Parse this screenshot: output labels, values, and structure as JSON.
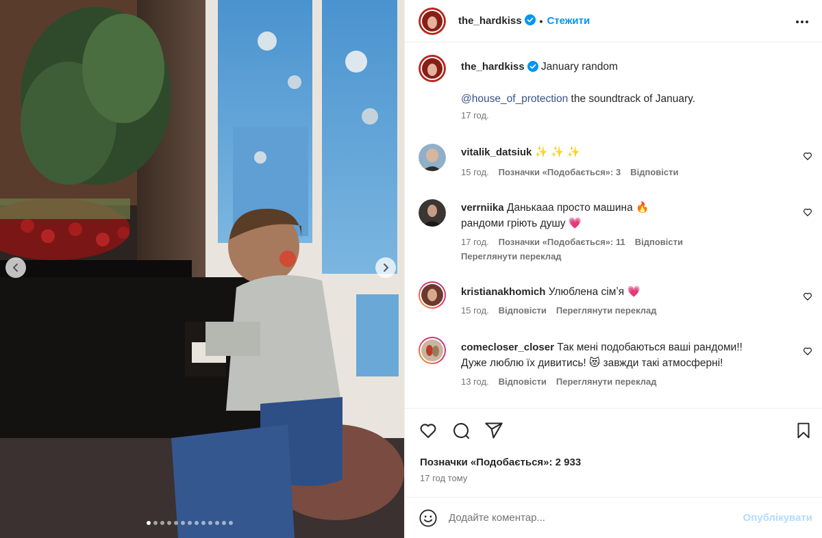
{
  "post": {
    "username": "the_hardkiss",
    "follow_label": "Стежити",
    "separator": "•",
    "more_icon": "more-horizontal-icon",
    "carousel_dots": 13,
    "carousel_active_index": 0
  },
  "caption": {
    "username": "the_hardkiss",
    "title": "January random",
    "mention": "@house_of_protection",
    "body": " the soundtrack of January.",
    "time": "17 год."
  },
  "comments": [
    {
      "username": "vitalik_datsiuk",
      "text": "✨ ✨ ✨",
      "time": "15 год.",
      "likes": "Позначки «Подобається»: 3",
      "reply": "Відповісти",
      "translate": ""
    },
    {
      "username": "verrniika",
      "text": "Данькааа просто машина 🔥",
      "text2": "рандоми гріють душу 💗",
      "time": "17 год.",
      "likes": "Позначки «Подобається»: 11",
      "reply": "Відповісти",
      "translate": "Переглянути переклад"
    },
    {
      "username": "kristianakhomich",
      "text": "Улюблена сімʼя 💗",
      "time": "15 год.",
      "reply": "Відповісти",
      "translate": "Переглянути переклад"
    },
    {
      "username": "comecloser_closer",
      "text": "Так мені подобаються ваші рандоми!!",
      "text2": "Дуже люблю їх дивитись! 😻 завжди такі атмосферні!",
      "time": "13 год.",
      "reply": "Відповісти",
      "translate": "Переглянути переклад"
    }
  ],
  "actions": {
    "likes": "Позначки «Подобається»: 2 933",
    "time": "17 год тому"
  },
  "comment_box": {
    "placeholder": "Додайте коментар...",
    "publish_label": "Опублікувати"
  },
  "colors": {
    "accent": "#0095f6",
    "mention": "#385185",
    "publish_disabled": "#b3dbff",
    "muted": "#737373"
  }
}
